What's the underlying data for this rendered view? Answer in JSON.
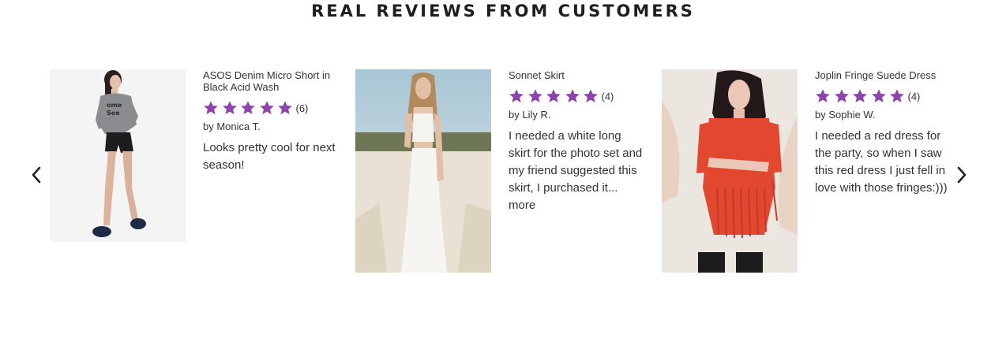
{
  "section": {
    "title": "REAL REVIEWS FROM CUSTOMERS"
  },
  "carousel": {
    "prev_icon": "chevron-left-icon",
    "next_icon": "chevron-right-icon"
  },
  "reviews": [
    {
      "product": "ASOS Denim Micro Short in Black Acid Wash",
      "rating": 5,
      "count": "(6)",
      "author": "by Monica T.",
      "text": "Looks pretty cool for next season!",
      "more": ""
    },
    {
      "product": "Sonnet Skirt",
      "rating": 5,
      "count": "(4)",
      "author": "by Lily R.",
      "text": "I needed a white long skirt for the photo set and my friend suggested this skirt, I purchased it...",
      "more": "more"
    },
    {
      "product": "Joplin Fringe Suede Dress",
      "rating": 5,
      "count": "(4)",
      "author": "by Sophie W.",
      "text": "I needed a red dress for the party, so when I saw this red dress I just fell in love with those fringes:)))",
      "more": ""
    }
  ],
  "colors": {
    "star": "#8e44ad",
    "text": "#333333",
    "title": "#1f1f1f"
  }
}
